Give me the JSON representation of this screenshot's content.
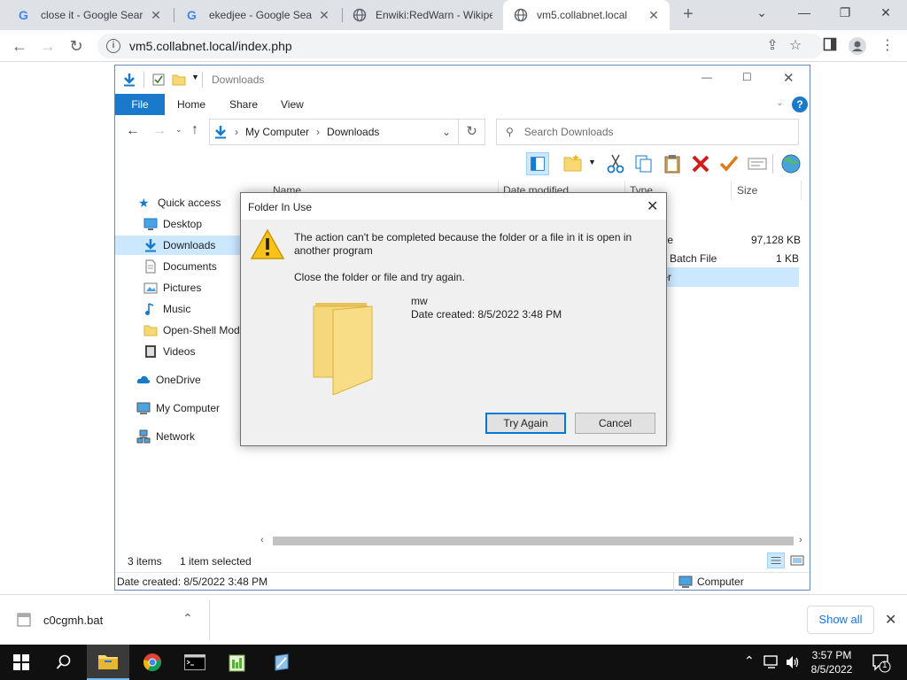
{
  "browser": {
    "tabs": [
      {
        "title": "close it - Google Search",
        "icon": "google-icon"
      },
      {
        "title": "ekedjee - Google Search",
        "icon": "google-icon"
      },
      {
        "title": "Enwiki:RedWarn - Wikipedia",
        "icon": "globe-icon"
      },
      {
        "title": "vm5.collabnet.local",
        "icon": "globe-icon",
        "active": true
      }
    ],
    "url": "vm5.collabnet.local/index.php"
  },
  "explorer": {
    "title": "Downloads",
    "ribbon_tabs": [
      "File",
      "Home",
      "Share",
      "View"
    ],
    "breadcrumb": [
      "My Computer",
      "Downloads"
    ],
    "search_placeholder": "Search Downloads",
    "nav": {
      "quick_access": "Quick access",
      "desktop": "Desktop",
      "downloads": "Downloads",
      "documents": "Documents",
      "pictures": "Pictures",
      "music": "Music",
      "openshell": "Open-Shell Mod",
      "videos": "Videos",
      "onedrive": "OneDrive",
      "mycomputer": "My Computer",
      "network": "Network"
    },
    "columns": {
      "name": "Name",
      "date": "Date modified",
      "type": "Type",
      "size": "Size"
    },
    "files": [
      {
        "type": "hive",
        "size": "97,128 KB"
      },
      {
        "type": "ws Batch File",
        "size": "1 KB"
      },
      {
        "type": "lder",
        "size": ""
      }
    ],
    "status": {
      "items": "3 items",
      "selected": "1 item selected"
    },
    "details": {
      "date_created": "Date created: 8/5/2022 3:48 PM",
      "location": "Computer"
    }
  },
  "dialog": {
    "title": "Folder In Use",
    "message_line1": "The action can't be completed because the folder or a file in it is open in",
    "message_line2": "another program",
    "instruction": "Close the folder or file and try again.",
    "item_name": "mw",
    "item_date": "Date created: 8/5/2022 3:48 PM",
    "try_again": "Try Again",
    "cancel": "Cancel"
  },
  "downloads_shelf": {
    "file": "c0cgmh.bat",
    "show_all": "Show all"
  },
  "taskbar": {
    "time": "3:57 PM",
    "date": "8/5/2022",
    "notification_count": "1"
  },
  "colors": {
    "accent": "#1979ca",
    "selection": "#cce8ff",
    "dialog_default_border": "#0078d7",
    "warning": "#f7c31a"
  }
}
